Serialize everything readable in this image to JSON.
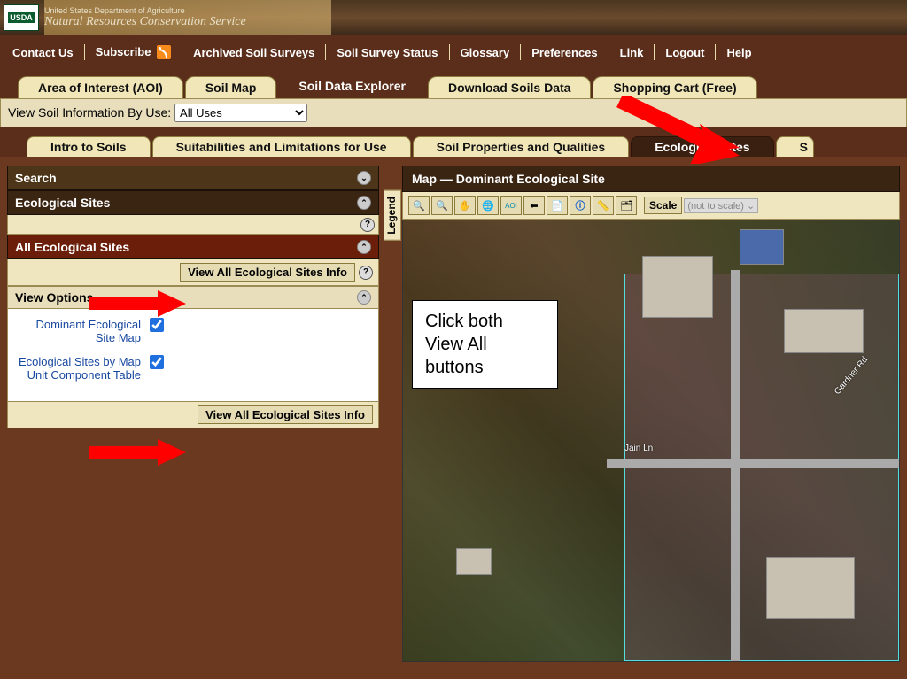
{
  "header": {
    "logo_text": "USDA",
    "line1": "United States Department of Agriculture",
    "line2": "Natural Resources Conservation Service"
  },
  "topnav": {
    "contact": "Contact Us",
    "subscribe": "Subscribe",
    "archived": "Archived Soil Surveys",
    "status": "Soil Survey Status",
    "glossary": "Glossary",
    "preferences": "Preferences",
    "link": "Link",
    "logout": "Logout",
    "help": "Help"
  },
  "main_tabs": {
    "aoi": "Area of Interest (AOI)",
    "soil_map": "Soil Map",
    "explorer": "Soil Data Explorer",
    "download": "Download Soils Data",
    "cart": "Shopping Cart (Free)"
  },
  "viewby": {
    "label": "View Soil Information By Use:",
    "selected": "All Uses"
  },
  "sub_tabs": {
    "intro": "Intro to Soils",
    "suit": "Suitabilities and Limitations for Use",
    "props": "Soil Properties and Qualities",
    "eco": "Ecological Sites",
    "cut": "S"
  },
  "left": {
    "search": "Search",
    "eco_sites": "Ecological Sites",
    "all_eco": "All Ecological Sites",
    "view_all_btn": "View All Ecological Sites Info",
    "view_options": "View Options",
    "opt1": "Dominant Ecological Site Map",
    "opt2": "Ecological Sites by Map Unit Component Table"
  },
  "right": {
    "map_title": "Map — Dominant Ecological Site",
    "legend": "Legend",
    "scale_label": "Scale",
    "scale_value": "(not to scale)",
    "street1": "Jain Ln",
    "street2": "Gardner Rd"
  },
  "annotation": {
    "text": "Click both View All buttons"
  }
}
